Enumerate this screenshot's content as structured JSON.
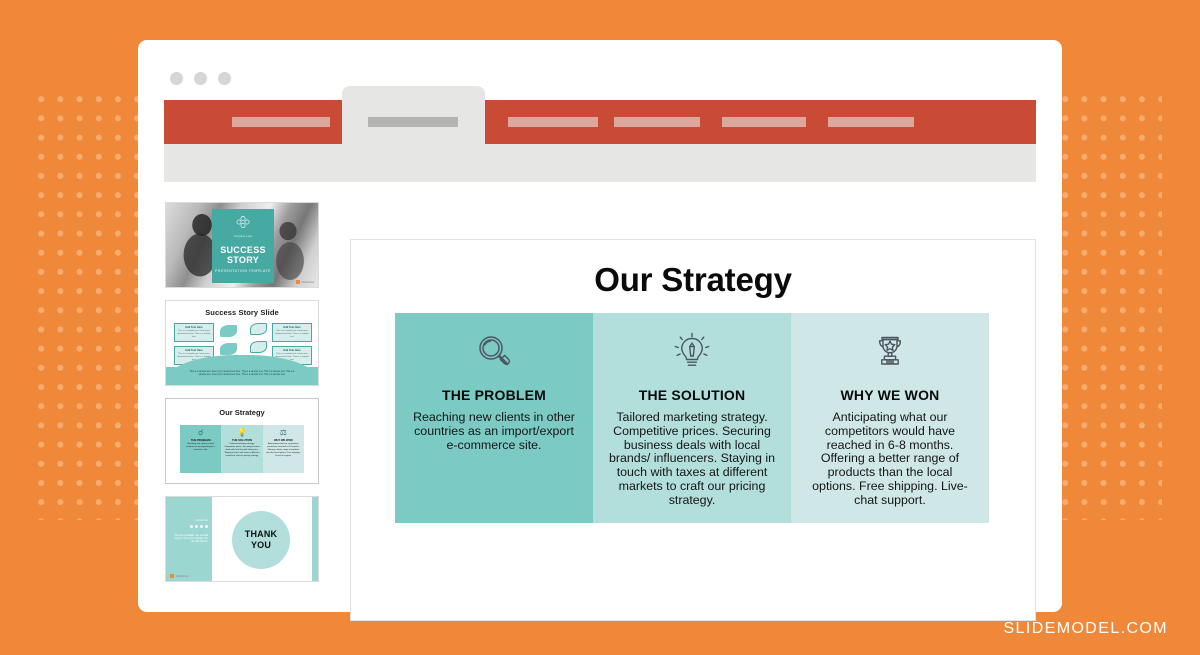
{
  "brand": {
    "footer_text": "SLIDEMODEL.COM",
    "accent_orange": "#F08839",
    "teal": "#7CCAC4"
  },
  "window": {
    "dots": [
      "window-dot-1",
      "window-dot-2",
      "window-dot-3"
    ],
    "tabstrip_color": "#C94B36",
    "tab_placeholders": [
      "",
      "",
      "",
      "",
      ""
    ],
    "active_tab_label": ""
  },
  "thumbnails": [
    {
      "index": "1",
      "name": "success-story-cover",
      "brandline": "Company Logo",
      "title_line1": "SUCCESS",
      "title_line2": "STORY",
      "subtitle": "PRESENTATION TEMPLATE",
      "badge": "SlideModel"
    },
    {
      "index": "2",
      "name": "success-story-slide",
      "title": "Success Story Slide",
      "boxes": [
        {
          "head": "Edit Text Here",
          "body": "This is a sample text. Insert your desired text here. This is a sample text."
        },
        {
          "head": "Edit Text Here",
          "body": "This is a sample text. Insert your desired text here. This is a sample text."
        },
        {
          "head": "Edit Text Here",
          "body": "This is a sample text. Insert your desired text here. This is a sample text."
        },
        {
          "head": "Edit Text Here",
          "body": "This is a sample text. Insert your desired text here. This is a sample text."
        }
      ],
      "footer": "This is a sample text. Insert your desired text here. This is a sample text. This is a sample text. This is a sample text. Insert your desired text here. This is a sample text. This is a sample text."
    },
    {
      "index": "3",
      "name": "our-strategy-slide",
      "title": "Our Strategy",
      "columns": [
        {
          "head": "THE PROBLEM",
          "body": "Reaching new clients in other countries as an import/export e-commerce site.",
          "icon": "magnifier-icon"
        },
        {
          "head": "THE SOLUTION",
          "body": "Tailored marketing strategy. Competitive prices. Securing business deals with local brands/ influencers. Staying in touch with taxes at different markets to craft our pricing strategy.",
          "icon": "lightbulb-icon"
        },
        {
          "head": "WHY WE WON",
          "body": "Anticipating what our competitors would have reached in 6-8 months. Offering a better range of products than the local options. Free shipping. Live-chat support.",
          "icon": "trophy-icon"
        }
      ]
    },
    {
      "index": "4",
      "name": "thank-you-slide",
      "contact_label": "Contact us",
      "side_text": "This text is editable. You can add the text. This text is editable. You can edit this text.",
      "title_line1": "THANK",
      "title_line2": "YOU",
      "badge": "SlideModel"
    }
  ],
  "slide": {
    "title": "Our Strategy",
    "columns": [
      {
        "icon": "magnifier-icon",
        "head": "THE PROBLEM",
        "body": "Reaching new clients in other countries as an import/export e-commerce site.",
        "bg": "#7CCAC4"
      },
      {
        "icon": "lightbulb-icon",
        "head": "THE SOLUTION",
        "body": "Tailored marketing strategy. Competitive prices. Securing business deals with local brands/ influencers. Staying in touch with taxes at different markets to craft our pricing strategy.",
        "bg": "#B2DEDB"
      },
      {
        "icon": "trophy-icon",
        "head": "WHY WE WON",
        "body": "Anticipating what our competitors would have reached in 6-8 months. Offering a better range of products than the local options. Free shipping. Live-chat support.",
        "bg": "#CFE8E7"
      }
    ]
  }
}
